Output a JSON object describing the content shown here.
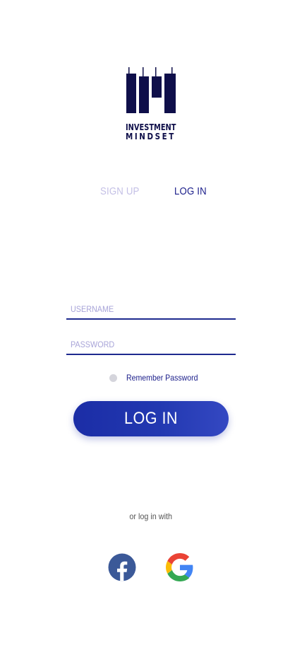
{
  "logo": {
    "line1": "INVESTMENT",
    "line2": "MINDSET"
  },
  "tabs": [
    {
      "label": "SIGN UP",
      "active": false
    },
    {
      "label": "LOG IN",
      "active": true
    }
  ],
  "form": {
    "username_placeholder": "USERNAME",
    "username_value": "",
    "password_placeholder": "PASSWORD",
    "password_value": "",
    "remember_label": "Remember Password",
    "remember_checked": false,
    "submit_label": "LOG IN"
  },
  "social": {
    "prompt": "or log in with",
    "providers": [
      {
        "name": "facebook",
        "icon": "facebook-icon"
      },
      {
        "name": "google",
        "icon": "google-icon"
      }
    ]
  },
  "colors": {
    "brand_navy": "#0f0f4a",
    "accent": "#1a1d8a",
    "tab_inactive": "#c4c0e6",
    "button_start": "#1b2da6",
    "button_end": "#3448c2",
    "facebook": "#3b5998"
  }
}
